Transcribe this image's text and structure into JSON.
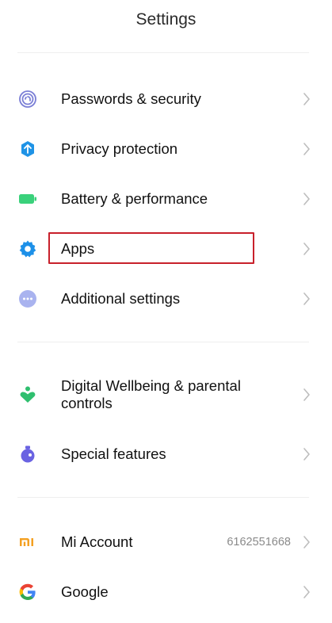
{
  "header": {
    "title": "Settings"
  },
  "sections": [
    {
      "items": [
        {
          "label": "Passwords & security",
          "icon": "fingerprint-icon",
          "icon_color": "#7b7fd6"
        },
        {
          "label": "Privacy protection",
          "icon": "privacy-shield-icon",
          "icon_color": "#1f93e6"
        },
        {
          "label": "Battery & performance",
          "icon": "battery-icon",
          "icon_color": "#3ad17b"
        },
        {
          "label": "Apps",
          "icon": "gear-icon",
          "icon_color": "#1d90e8",
          "highlighted": true
        },
        {
          "label": "Additional settings",
          "icon": "more-dots-icon",
          "icon_color": "#8f9be8"
        }
      ]
    },
    {
      "items": [
        {
          "label": "Digital Wellbeing & parental controls",
          "icon": "wellbeing-icon",
          "icon_color": "#2fbf6f"
        },
        {
          "label": "Special features",
          "icon": "potion-icon",
          "icon_color": "#6a63e2"
        }
      ]
    },
    {
      "items": [
        {
          "label": "Mi Account",
          "value": "6162551668",
          "icon": "mi-logo-icon",
          "icon_color": "#f4a021"
        },
        {
          "label": "Google",
          "icon": "google-icon",
          "icon_color": "#4285f4"
        }
      ]
    }
  ],
  "annotation": {
    "highlight_color": "#c8202b"
  }
}
